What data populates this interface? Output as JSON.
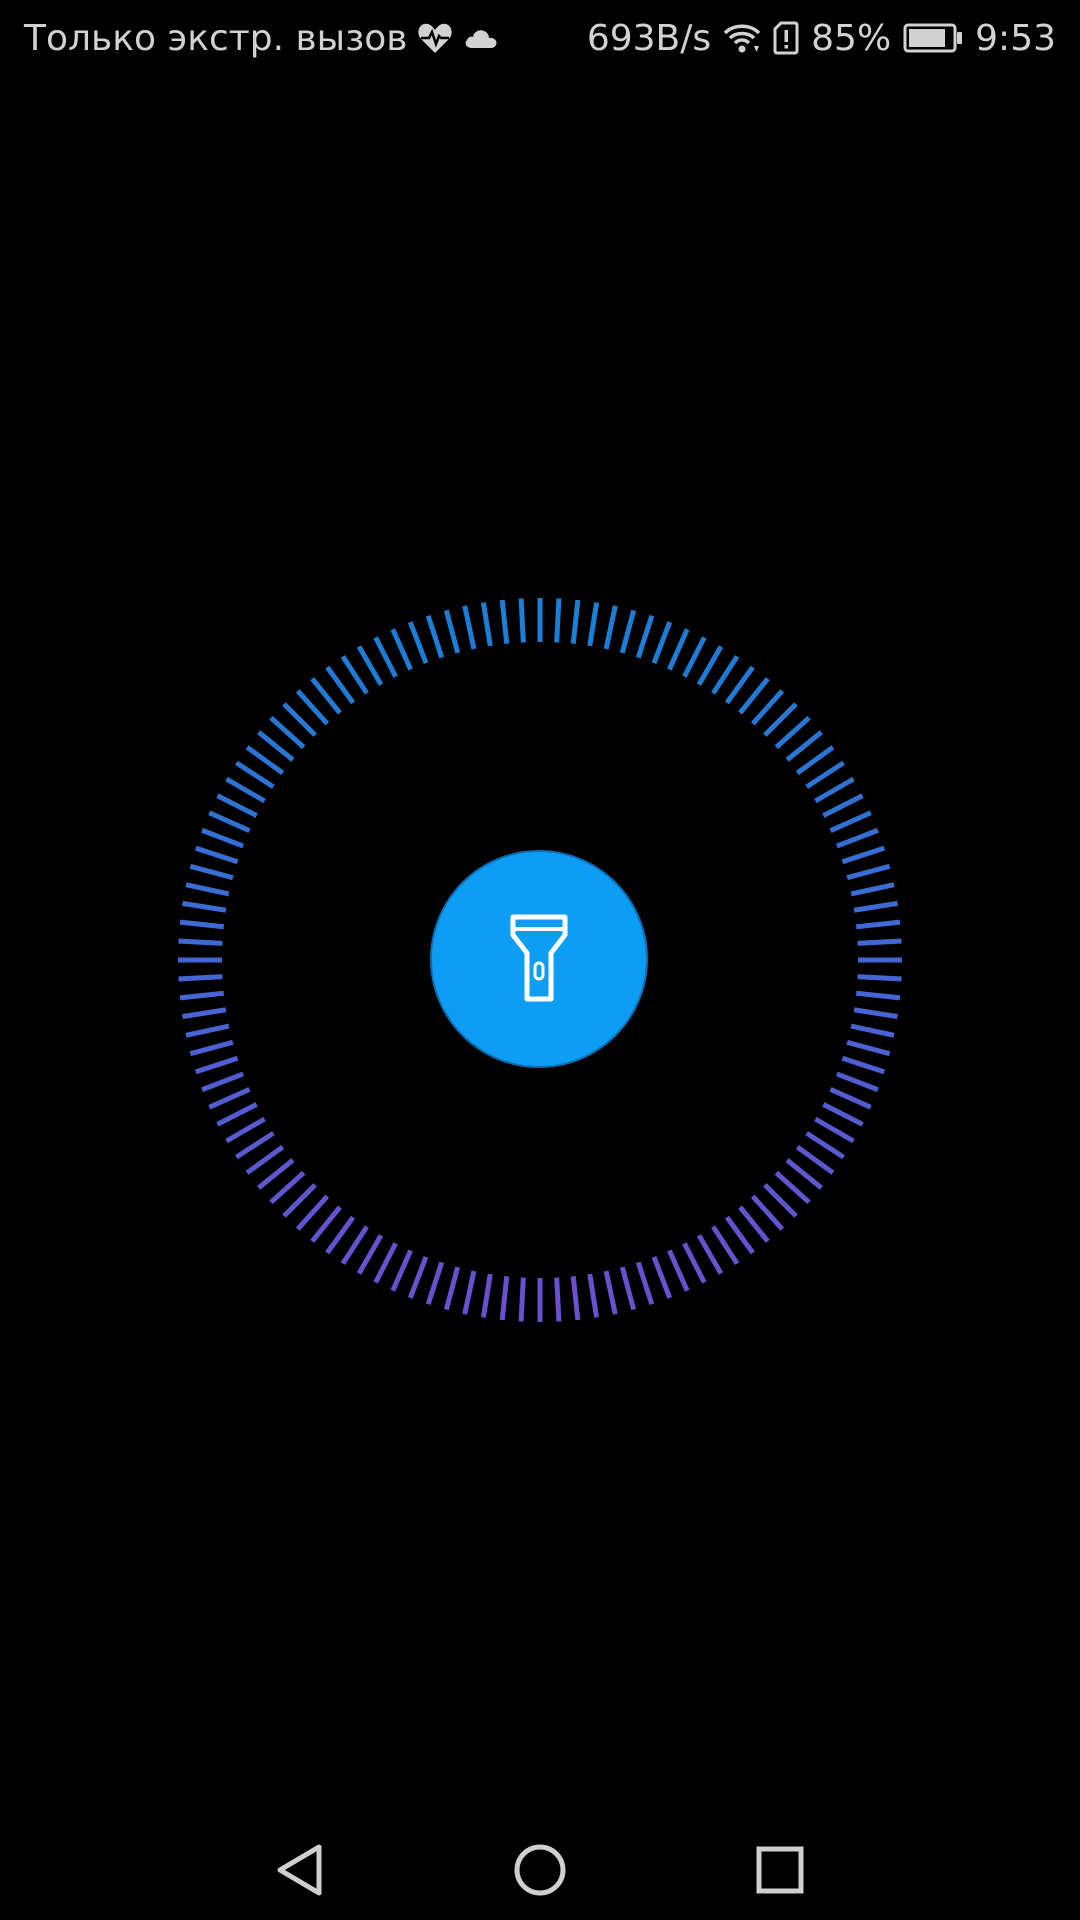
{
  "status_bar": {
    "carrier_text": "Только экстр. вызов",
    "network_speed": "693B/s",
    "battery_percent": "85%",
    "time": "9:53",
    "icons": [
      "heart-pulse-icon",
      "cloud-icon",
      "wifi-icon",
      "sim-alert-icon",
      "battery-icon"
    ]
  },
  "flashlight": {
    "button_icon": "flashlight-icon",
    "state": "off",
    "ring_colors": {
      "top": "#1a7fd6",
      "bottom": "#6a4fcf"
    },
    "button_color": "#0d9df5"
  },
  "nav_bar": {
    "buttons": [
      "back-icon",
      "home-icon",
      "recents-icon"
    ]
  }
}
